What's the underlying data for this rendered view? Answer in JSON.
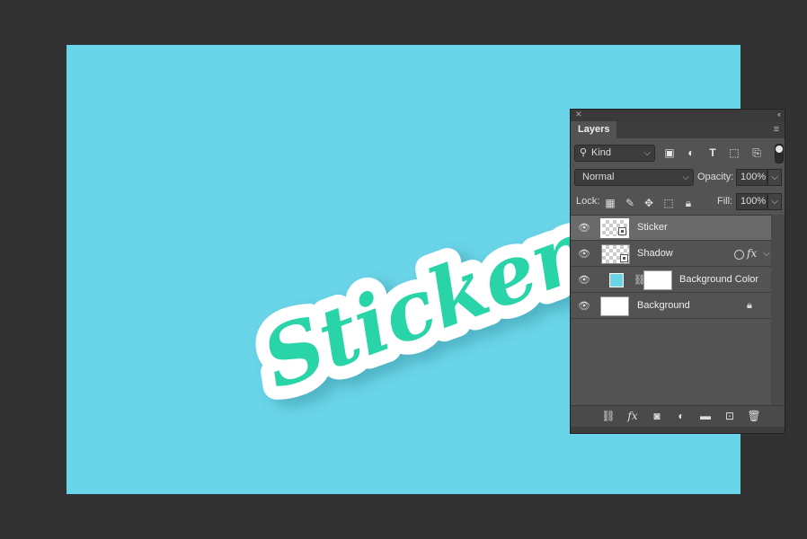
{
  "canvas": {
    "background_color": "#6ad4e8",
    "sticker_text": "Sticker",
    "sticker_text_color": "#28d4a8",
    "sticker_outline_color": "#ffffff"
  },
  "panel": {
    "tab_label": "Layers",
    "filter": {
      "kind_label": "Kind"
    },
    "blend_mode": "Normal",
    "opacity_label": "Opacity:",
    "opacity_value": "100%",
    "lock_label": "Lock:",
    "fill_label": "Fill:",
    "fill_value": "100%",
    "layers": [
      {
        "name": "Sticker",
        "selected": true
      },
      {
        "name": "Shadow",
        "has_fx": true,
        "fx_label": "fx"
      },
      {
        "name": "Background Color",
        "fill_color": "#6ad4e8"
      },
      {
        "name": "Background",
        "locked": true
      }
    ],
    "icons": {
      "filter": [
        "image-filter-icon",
        "adjustment-filter-icon",
        "type-filter-icon",
        "shape-filter-icon",
        "smart-object-filter-icon"
      ],
      "lock": [
        "lock-transparent-icon",
        "lock-brush-icon",
        "lock-move-icon",
        "lock-artboard-icon",
        "lock-all-icon"
      ],
      "bottom": [
        "link-icon",
        "fx-icon",
        "mask-icon",
        "adjustment-icon",
        "folder-icon",
        "new-layer-icon",
        "trash-icon"
      ]
    },
    "bottom_fx_label": "fx"
  }
}
